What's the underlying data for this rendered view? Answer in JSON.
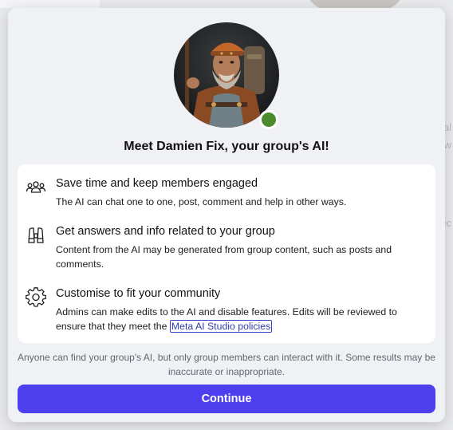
{
  "background": {
    "side_text_1": "al",
    "side_text_2": "w",
    "side_text_3": "ec"
  },
  "dialog": {
    "title": "Meet Damien Fix, your group's AI!",
    "avatar": {
      "description_icon": "ai-character-portrait",
      "status_color": "#4c8a2e"
    },
    "features": [
      {
        "icon": "people-group-icon",
        "title": "Save time and keep members engaged",
        "description": "The AI can chat one to one, post, comment and help in other ways."
      },
      {
        "icon": "binoculars-icon",
        "title": "Get answers and info related to your group",
        "description": "Content from the AI may be generated from group content, such as posts and comments."
      },
      {
        "icon": "gear-icon",
        "title": "Customise to fit your community",
        "description": "Admins can make edits to the AI and disable features. Edits will be reviewed to ensure that they meet the",
        "link_text": "Meta AI Studio policies"
      }
    ],
    "footnote": "Anyone can find your group's AI, but only group members can interact with it. Some results may be inaccurate or inappropriate.",
    "continue_label": "Continue",
    "accent_color": "#4d3fee"
  }
}
